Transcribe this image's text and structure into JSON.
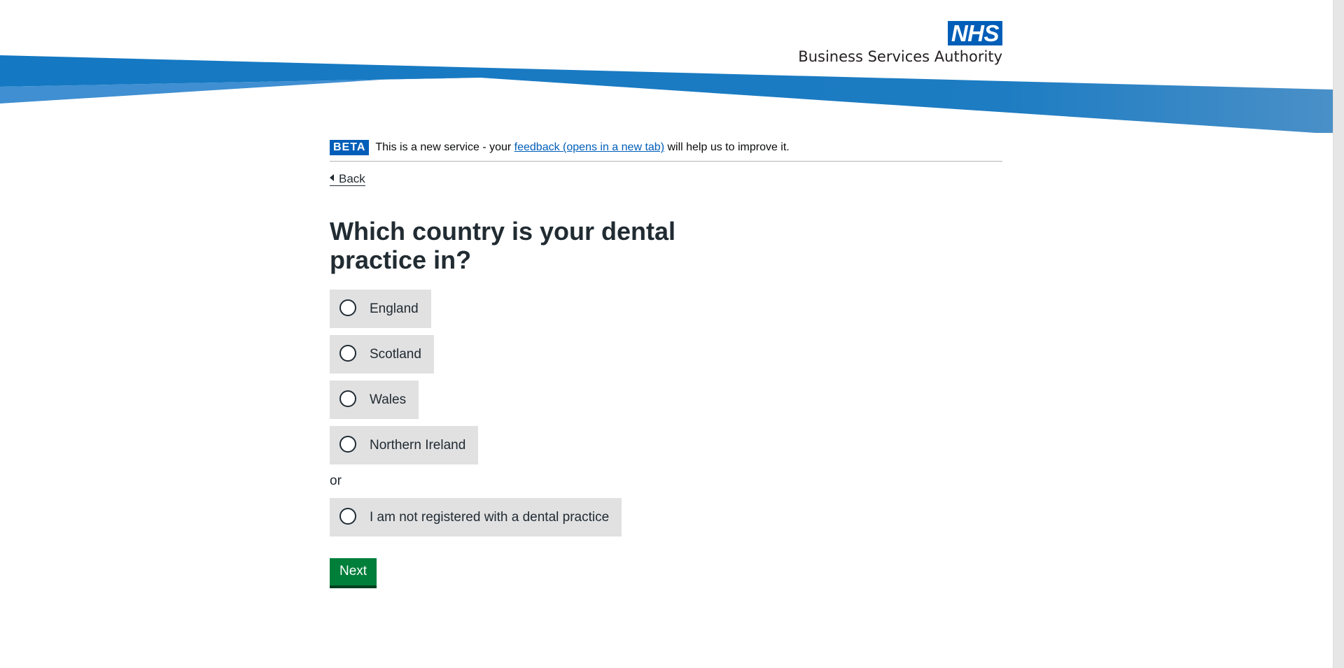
{
  "header": {
    "logo_text": "NHS",
    "org_name": "Business Services Authority",
    "brand_color": "#005eb8"
  },
  "phase_banner": {
    "tag": "BETA",
    "text_before": "This is a new service - your ",
    "link_text": "feedback (opens in a new tab)",
    "text_after": " will help us to improve it."
  },
  "back_link": {
    "label": "Back",
    "icon": "chevron-left-icon"
  },
  "question": {
    "title": "Which country is your dental practice in?"
  },
  "radios": {
    "options": [
      {
        "label": "England",
        "selected": false
      },
      {
        "label": "Scotland",
        "selected": false
      },
      {
        "label": "Wales",
        "selected": false
      },
      {
        "label": "Northern Ireland",
        "selected": false
      }
    ],
    "divider": "or",
    "alternate": {
      "label": "I am not registered with a dental practice",
      "selected": false
    }
  },
  "actions": {
    "next_label": "Next",
    "button_color": "#007f3b"
  }
}
